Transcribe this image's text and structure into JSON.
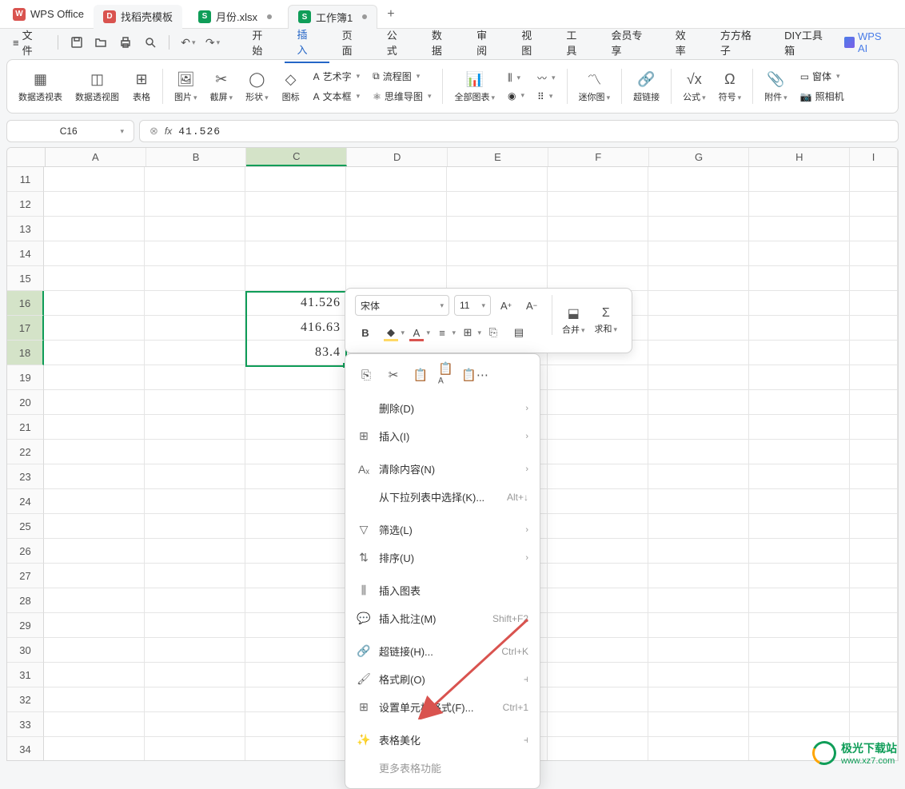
{
  "title_bar": {
    "app_name": "WPS Office",
    "tabs": [
      {
        "label": "找稻壳模板",
        "icon": "D"
      },
      {
        "label": "月份.xlsx",
        "icon": "S",
        "dot": true
      },
      {
        "label": "工作簿1",
        "icon": "S",
        "dot": true
      }
    ],
    "add": "+"
  },
  "menu": {
    "file": "文件",
    "tabs": [
      "开始",
      "插入",
      "页面",
      "公式",
      "数据",
      "审阅",
      "视图",
      "工具",
      "会员专享",
      "效率",
      "方方格子",
      "DIY工具箱"
    ],
    "active_tab_index": 1,
    "ai": "WPS AI"
  },
  "ribbon": {
    "groups": [
      {
        "label": "数据透视表",
        "icon": "pivot-table"
      },
      {
        "label": "数据透视图",
        "icon": "pivot-chart"
      },
      {
        "label": "表格",
        "icon": "table"
      }
    ],
    "groups2": [
      {
        "label": "图片",
        "icon": "image",
        "dd": true
      },
      {
        "label": "截屏",
        "icon": "screenshot",
        "dd": true
      },
      {
        "label": "形状",
        "icon": "shapes",
        "dd": true
      },
      {
        "label": "图标",
        "icon": "icons"
      }
    ],
    "stacks": [
      {
        "label": "艺术字",
        "icon": "A"
      },
      {
        "label": "文本框",
        "icon": "A"
      }
    ],
    "stacks2": [
      {
        "label": "流程图",
        "icon": "flow"
      },
      {
        "label": "思维导图",
        "icon": "mind"
      }
    ],
    "charts": {
      "label": "全部图表"
    },
    "sparklines": {
      "label": "迷你图"
    },
    "hyperlink": {
      "label": "超链接"
    },
    "formula_sym": {
      "label": "公式"
    },
    "symbol": {
      "label": "符号"
    },
    "attach": {
      "label": "附件"
    },
    "window": {
      "label": "窗体"
    },
    "camera": {
      "label": "照相机"
    }
  },
  "formula_bar": {
    "name": "C16",
    "fx": "fx",
    "value": "41.526"
  },
  "grid": {
    "cols": [
      "A",
      "B",
      "C",
      "D",
      "E",
      "F",
      "G",
      "H",
      "I"
    ],
    "rows": [
      "11",
      "12",
      "13",
      "14",
      "15",
      "16",
      "17",
      "18",
      "19",
      "20",
      "21",
      "22",
      "23",
      "24",
      "25",
      "26",
      "27",
      "28",
      "29",
      "30",
      "31",
      "32",
      "33",
      "34"
    ],
    "selected_col_index": 2,
    "selected_row_start": 5,
    "selected_row_end": 7,
    "cells": {
      "C16": "41.526",
      "C17": "416.63",
      "C18": "83.4"
    }
  },
  "mini_toolbar": {
    "font": "宋体",
    "size": "11",
    "a_plus": "A⁺",
    "a_minus": "A⁻",
    "bold": "B",
    "merge": "合并",
    "sum": "求和"
  },
  "context_menu": {
    "items": [
      {
        "label": "删除(D)",
        "icon": "",
        "chevron": true
      },
      {
        "label": "插入(I)",
        "icon": "insert",
        "chevron": true
      },
      {
        "label": "清除内容(N)",
        "icon": "clear",
        "chevron": true
      },
      {
        "label": "从下拉列表中选择(K)...",
        "icon": "",
        "shortcut": "Alt+↓"
      },
      {
        "label": "筛选(L)",
        "icon": "filter",
        "chevron": true
      },
      {
        "label": "排序(U)",
        "icon": "sort",
        "chevron": true
      },
      {
        "label": "插入图表",
        "icon": "chart"
      },
      {
        "label": "插入批注(M)",
        "icon": "comment",
        "shortcut": "Shift+F2"
      },
      {
        "label": "超链接(H)...",
        "icon": "link",
        "shortcut": "Ctrl+K"
      },
      {
        "label": "格式刷(O)",
        "icon": "brush",
        "right_icon": true
      },
      {
        "label": "设置单元格格式(F)...",
        "icon": "format",
        "shortcut": "Ctrl+1"
      },
      {
        "label": "表格美化",
        "icon": "beautify",
        "right_icon": true
      },
      {
        "label": "更多表格功能",
        "icon": ""
      }
    ]
  },
  "watermark": {
    "t1": "极光下载站",
    "t2": "www.xz7.com"
  }
}
